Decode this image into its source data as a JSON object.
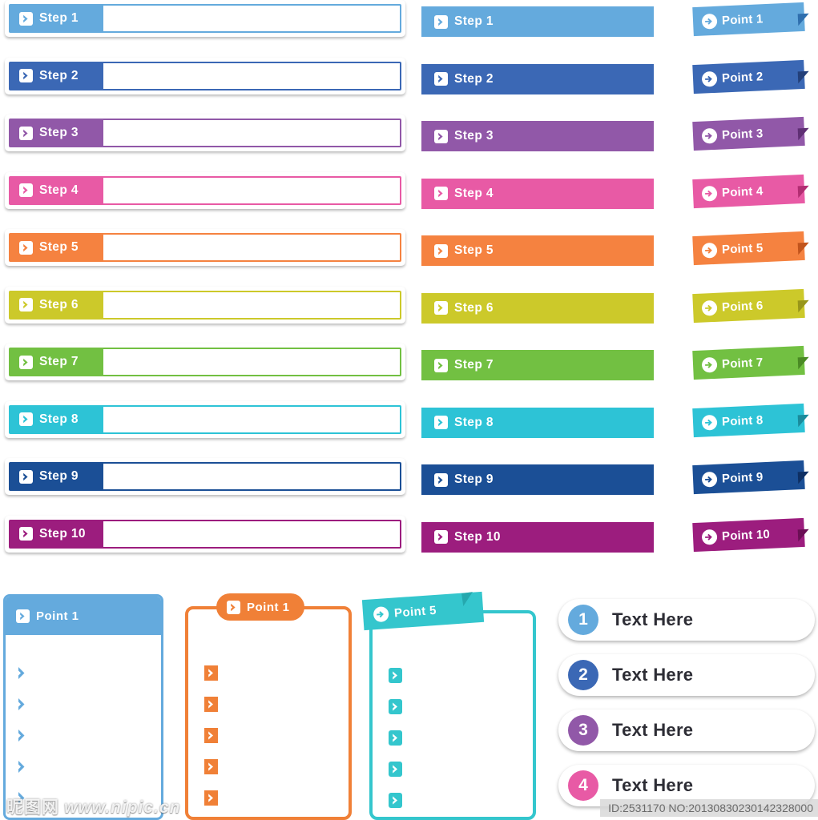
{
  "columns": {
    "outlined_steps": {
      "name": "outlined-step-bars",
      "items": [
        {
          "label": "Step 1",
          "color": "#64aadd"
        },
        {
          "label": "Step 2",
          "color": "#3b68b5"
        },
        {
          "label": "Step 3",
          "color": "#9158a8"
        },
        {
          "label": "Step 4",
          "color": "#e85aa5"
        },
        {
          "label": "Step 5",
          "color": "#f58240"
        },
        {
          "label": "Step 6",
          "color": "#ccc92a"
        },
        {
          "label": "Step 7",
          "color": "#72c042"
        },
        {
          "label": "Step 8",
          "color": "#2dc3d6"
        },
        {
          "label": "Step 9",
          "color": "#1b4f96"
        },
        {
          "label": "Step 10",
          "color": "#9c1d7e"
        }
      ]
    },
    "solid_steps": {
      "name": "solid-step-bars",
      "items": [
        {
          "label": "Step 1",
          "color": "#64aadd"
        },
        {
          "label": "Step 2",
          "color": "#3b68b5"
        },
        {
          "label": "Step 3",
          "color": "#9158a8"
        },
        {
          "label": "Step 4",
          "color": "#e85aa5"
        },
        {
          "label": "Step 5",
          "color": "#f58240"
        },
        {
          "label": "Step 6",
          "color": "#ccc92a"
        },
        {
          "label": "Step 7",
          "color": "#72c042"
        },
        {
          "label": "Step 8",
          "color": "#2dc3d6"
        },
        {
          "label": "Step 9",
          "color": "#1b4f96"
        },
        {
          "label": "Step 10",
          "color": "#9c1d7e"
        }
      ]
    },
    "ribbons": {
      "name": "point-ribbons",
      "items": [
        {
          "label": "Point 1",
          "color": "#64aadd",
          "fold_color": "#2f6fae"
        },
        {
          "label": "Point 2",
          "color": "#3b68b5",
          "fold_color": "#23407a"
        },
        {
          "label": "Point 3",
          "color": "#9158a8",
          "fold_color": "#5f2f74"
        },
        {
          "label": "Point 4",
          "color": "#e85aa5",
          "fold_color": "#b22d72"
        },
        {
          "label": "Point 5",
          "color": "#f58240",
          "fold_color": "#c2541c"
        },
        {
          "label": "Point 6",
          "color": "#ccc92a",
          "fold_color": "#98961a"
        },
        {
          "label": "Point 7",
          "color": "#72c042",
          "fold_color": "#4a8a24"
        },
        {
          "label": "Point 8",
          "color": "#2dc3d6",
          "fold_color": "#1a8b9b"
        },
        {
          "label": "Point 9",
          "color": "#1b4f96",
          "fold_color": "#0e2f63"
        },
        {
          "label": "Point 10",
          "color": "#9c1d7e",
          "fold_color": "#6b0f55"
        }
      ]
    }
  },
  "panels": {
    "blue_panel": {
      "title": "Point 1",
      "color": "#64aadd",
      "bullet_count": 5,
      "bullet_style": "plain-chevron"
    },
    "orange_panel": {
      "title": "Point 1",
      "color": "#f08037",
      "bullet_count": 5,
      "bullet_style": "square-chevron"
    },
    "teal_panel": {
      "title": "Point 5",
      "color": "#34c6cd",
      "fold_color": "#25a8ae",
      "bullet_count": 5,
      "bullet_style": "rounded-square-chevron"
    }
  },
  "text_buttons": {
    "name": "text-here-buttons",
    "items": [
      {
        "number": "1",
        "label": "Text Here",
        "color": "#64aadd"
      },
      {
        "number": "2",
        "label": "Text Here",
        "color": "#3b68b5"
      },
      {
        "number": "3",
        "label": "Text Here",
        "color": "#9158a8"
      },
      {
        "number": "4",
        "label": "Text Here",
        "color": "#e85aa5"
      }
    ]
  },
  "watermark": {
    "site_cn": "昵图网",
    "site_url": "www.nipic.cn",
    "id_text": "ID:2531170 NO:20130830230142328000"
  }
}
